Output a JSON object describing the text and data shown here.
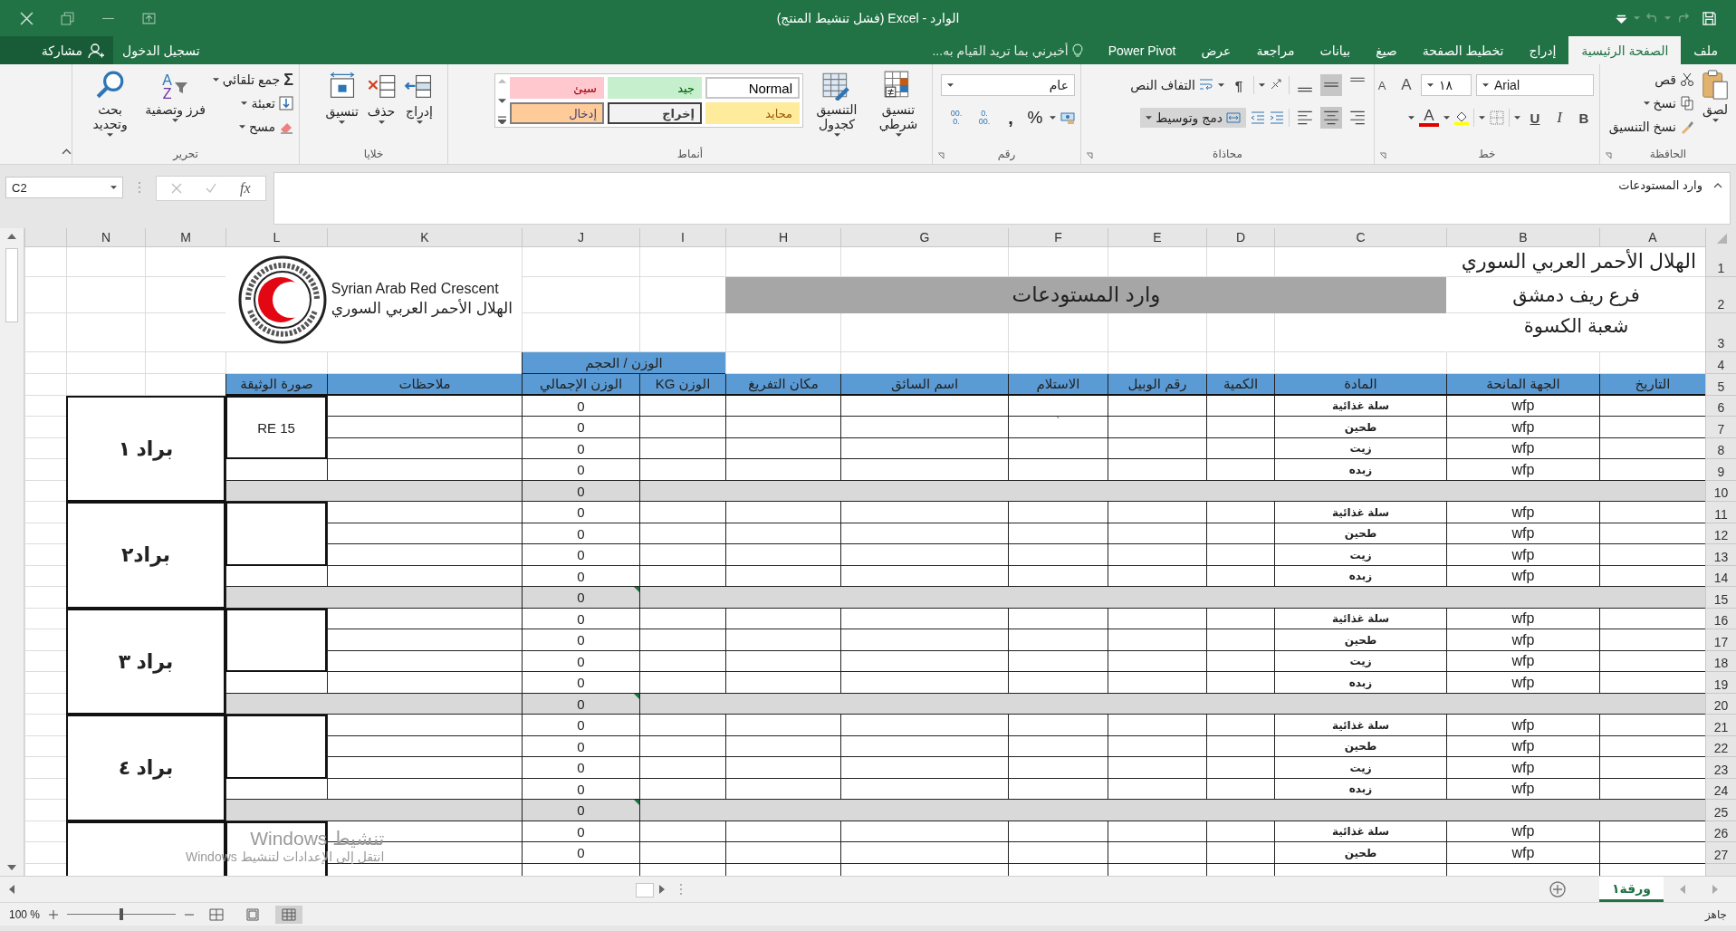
{
  "title_bar": {
    "title": "الوارد - Excel (فشل تنشيط المنتج)"
  },
  "menu": {
    "tabs": [
      {
        "label": "ملف",
        "selected": false
      },
      {
        "label": "الصفحة الرئيسية",
        "selected": true
      },
      {
        "label": "إدراج",
        "selected": false
      },
      {
        "label": "تخطيط الصفحة",
        "selected": false
      },
      {
        "label": "صيغ",
        "selected": false
      },
      {
        "label": "بيانات",
        "selected": false
      },
      {
        "label": "مراجعة",
        "selected": false
      },
      {
        "label": "عرض",
        "selected": false
      },
      {
        "label": "Power Pivot",
        "selected": false
      }
    ],
    "tell_me": "أخبرني بما تريد القيام به...",
    "sign_in": "تسجيل الدخول",
    "share": "مشاركة"
  },
  "ribbon": {
    "clipboard": {
      "name": "الحافظة",
      "paste": "لصق",
      "cut": "قص",
      "copy": "نسخ",
      "format_painter": "نسخ التنسيق"
    },
    "font": {
      "name": "خط",
      "font_name": "Arial",
      "font_size": "١٨",
      "grow": "A",
      "shrink": "A",
      "bold": "B",
      "italic": "I",
      "underline": "U",
      "font_color": "A"
    },
    "alignment": {
      "name": "محاذاة",
      "vertical_align": [
        {
          "kind": "top",
          "selected": false
        },
        {
          "kind": "middle",
          "selected": true
        },
        {
          "kind": "bottom",
          "selected": false
        }
      ],
      "horizontal_align": [
        {
          "kind": "right",
          "selected": false
        },
        {
          "kind": "center",
          "selected": true
        },
        {
          "kind": "left",
          "selected": false
        }
      ],
      "paragraph": "¶",
      "wrap_text": "التفاف النص",
      "merge_center": {
        "label": "دمج وتوسيط",
        "selected": true
      }
    },
    "number": {
      "name": "رقم",
      "format": "عام",
      "percent": "%",
      "comma": ",",
      "decimals": [
        {
          "top": ".0",
          "bottom": ".00"
        },
        {
          "top": ".00",
          "bottom": ".0"
        }
      ]
    },
    "styles": {
      "name": "أنماط",
      "conditional": "تنسيق شرطي",
      "as_table": "التنسيق كجدول",
      "gallery": [
        {
          "label": "Normal",
          "kind": "normal"
        },
        {
          "label": "جيد",
          "kind": "good"
        },
        {
          "label": "سيئ",
          "kind": "bad"
        },
        {
          "label": "محايد",
          "kind": "neutral"
        },
        {
          "label": "إخراج",
          "kind": "output"
        },
        {
          "label": "إدخال",
          "kind": "input"
        }
      ]
    },
    "cells": {
      "name": "خلايا",
      "buttons": [
        {
          "label": "إدراج",
          "kind": "insert"
        },
        {
          "label": "حذف",
          "kind": "delete"
        },
        {
          "label": "تنسيق",
          "kind": "format"
        }
      ]
    },
    "editing": {
      "name": "تحرير",
      "sigma": "Σ",
      "autosum": "جمع تلقائي",
      "fill": "تعبئة",
      "clear": "مسح",
      "sort_letters": [
        "A",
        "Z"
      ],
      "sort": "فرز وتصفية",
      "find": "بحث وتحديد"
    }
  },
  "formula_bar": {
    "name_box": "C2",
    "fx": "fx",
    "formula": "وارد المستودعات"
  },
  "sheet": {
    "columns": [
      "A",
      "B",
      "C",
      "D",
      "E",
      "F",
      "G",
      "H",
      "I",
      "J",
      "K",
      "L",
      "M",
      "N"
    ],
    "row_numbers": [
      "1",
      "2",
      "3",
      "4",
      "5",
      "6",
      "7",
      "8",
      "9",
      "10",
      "11",
      "12",
      "13",
      "14",
      "15",
      "16",
      "17",
      "18",
      "19",
      "20",
      "21",
      "22",
      "23",
      "24",
      "25",
      "26",
      "27"
    ],
    "org_name": "الهلال الأحمر العربي السوري",
    "branch": "فرع ريف دمشق",
    "division": "شعبة الكسوة",
    "title": "وارد المستودعات",
    "logo": {
      "english": "Syrian Arab Red Crescent",
      "arabic": "الهلال الأحمر العربي السوري"
    },
    "weight_header": "الوزن / الحجم",
    "headers": [
      "التاريخ",
      "الجهة المانحة",
      "المادة",
      "الكمية",
      "رقم الوبيل",
      "الاستلام",
      "اسم السائق",
      "مكان التفريغ",
      "الوزن KG",
      "الوزن الإجمالي",
      "ملاحظات",
      "صورة الوثيقة"
    ],
    "groups": [
      {
        "label": "براد ١",
        "document": "RE 15",
        "subtotal": "0",
        "error_indicator": false,
        "rows": [
          {
            "donor": "wfp",
            "material": "سلة غذائية",
            "total": "0"
          },
          {
            "donor": "wfp",
            "material": "طحين",
            "receipt": "`",
            "total": "0"
          },
          {
            "donor": "wfp",
            "material": "زيت",
            "total": "0"
          },
          {
            "donor": "wfp",
            "material": "زبده",
            "total": "0"
          }
        ]
      },
      {
        "label": "براد٢",
        "subtotal": "0",
        "error_indicator": true,
        "rows": [
          {
            "donor": "wfp",
            "material": "سلة غذائية",
            "total": "0"
          },
          {
            "donor": "wfp",
            "material": "طحين",
            "total": "0"
          },
          {
            "donor": "wfp",
            "material": "زيت",
            "total": "0"
          },
          {
            "donor": "wfp",
            "material": "زبده",
            "total": "0"
          }
        ]
      },
      {
        "label": "براد ٣",
        "subtotal": "0",
        "error_indicator": true,
        "rows": [
          {
            "donor": "wfp",
            "material": "سلة غذائية",
            "total": "0"
          },
          {
            "donor": "wfp",
            "material": "طحين",
            "total": "0"
          },
          {
            "donor": "wfp",
            "material": "زيت",
            "total": "0"
          },
          {
            "donor": "wfp",
            "material": "زبده",
            "total": "0"
          }
        ]
      },
      {
        "label": "براد ٤",
        "subtotal": "0",
        "error_indicator": true,
        "rows": [
          {
            "donor": "wfp",
            "material": "سلة غذائية",
            "total": "0"
          },
          {
            "donor": "wfp",
            "material": "طحين",
            "total": "0"
          },
          {
            "donor": "wfp",
            "material": "زيت",
            "total": "0"
          },
          {
            "donor": "wfp",
            "material": "زبده",
            "total": "0"
          }
        ]
      },
      {
        "rows": [
          {
            "donor": "wfp",
            "material": "سلة غذائية",
            "total": "0"
          },
          {
            "donor": "wfp",
            "material": "طحين",
            "total": "0"
          }
        ]
      }
    ]
  },
  "activation": {
    "title": "تنشيط Windows",
    "hint": "انتقل إلى الإعدادات لتنشيط Windows"
  },
  "sheet_tabs": [
    {
      "label": "ورقة١",
      "selected": true
    }
  ],
  "status": {
    "text": "جاهز",
    "zoom": {
      "reading": "100 %",
      "level": 0.5
    },
    "views": [
      {
        "kind": "page_break",
        "selected": false
      },
      {
        "kind": "page_layout",
        "selected": false
      },
      {
        "kind": "normal",
        "selected": true
      }
    ]
  }
}
